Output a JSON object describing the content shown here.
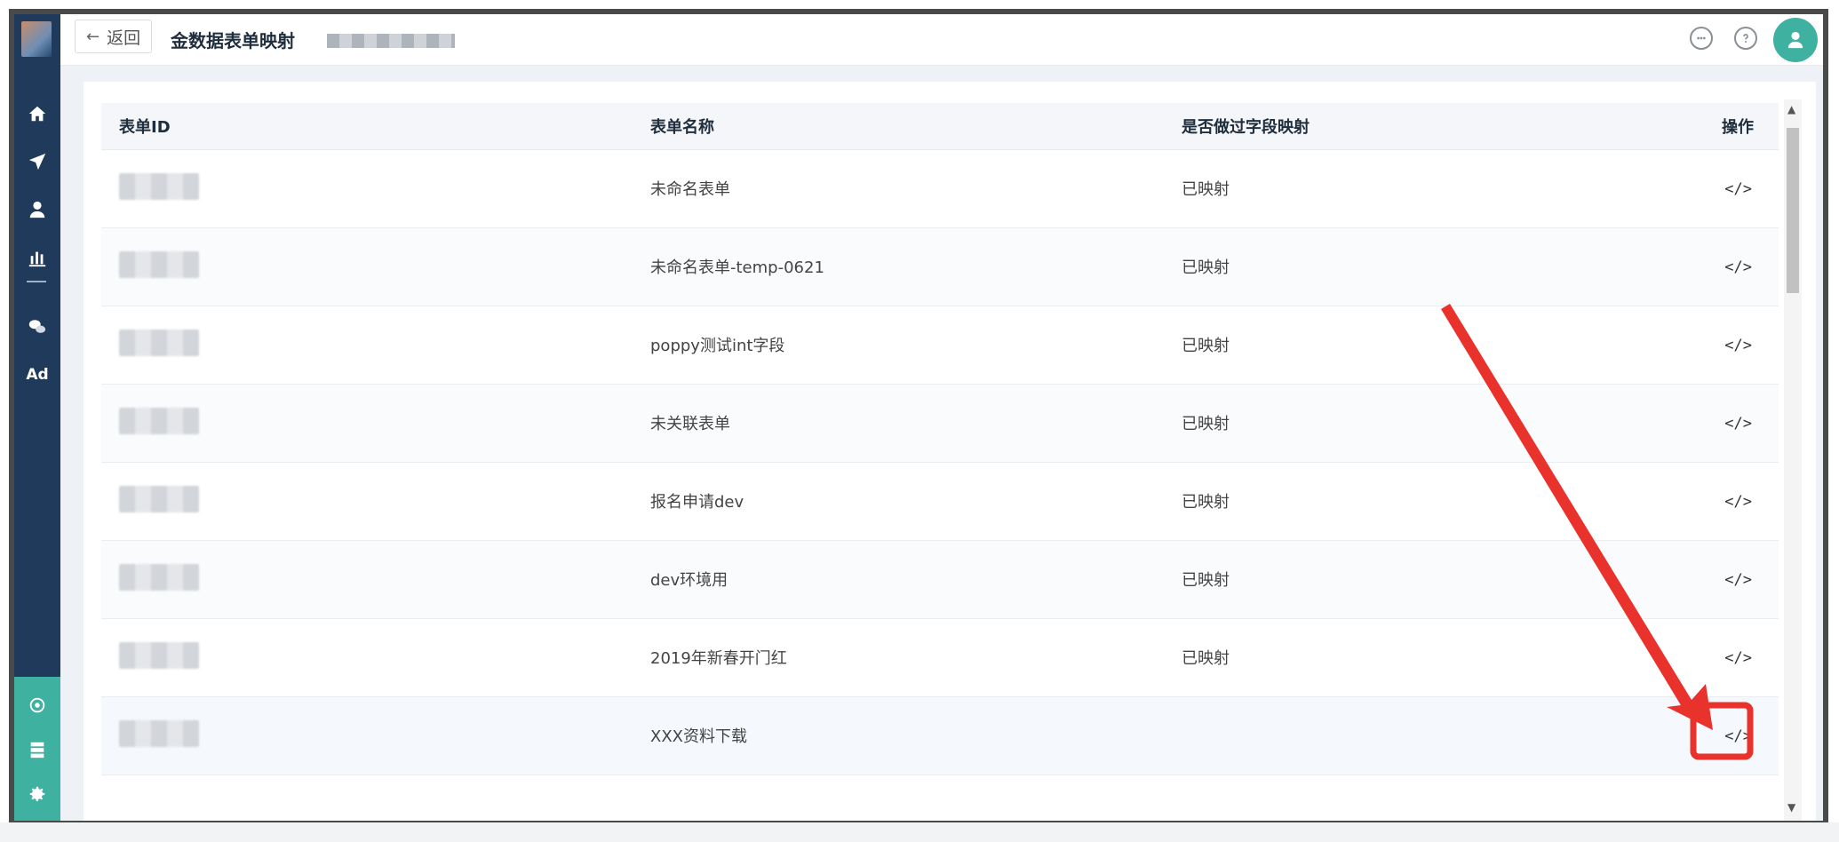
{
  "header": {
    "back_label": "返回",
    "back_arrow": "←",
    "title": "金数据表单映射"
  },
  "icons": {
    "sidebar": [
      "home-icon",
      "send-icon",
      "user-icon",
      "bar-chart-icon",
      "wechat-icon",
      "ad-icon",
      "hub-icon",
      "server-icon",
      "settings-icon"
    ],
    "top": [
      "chat-icon",
      "help-icon",
      "user-avatar-icon"
    ]
  },
  "sidebar": {
    "ad_label": "Ad"
  },
  "table": {
    "columns": [
      "表单ID",
      "表单名称",
      "是否做过字段映射",
      "操作"
    ],
    "rows": [
      {
        "name": "未命名表单",
        "mapped": "已映射",
        "action": "</>"
      },
      {
        "name": "未命名表单-temp-0621",
        "mapped": "已映射",
        "action": "</>"
      },
      {
        "name": "poppy测试int字段",
        "mapped": "已映射",
        "action": "</>"
      },
      {
        "name": "未关联表单",
        "mapped": "已映射",
        "action": "</>"
      },
      {
        "name": "报名申请dev",
        "mapped": "已映射",
        "action": "</>"
      },
      {
        "name": "dev环境用",
        "mapped": "已映射",
        "action": "</>"
      },
      {
        "name": "2019年新春开门红",
        "mapped": "已映射",
        "action": "</>"
      },
      {
        "name": "XXX资料下载",
        "mapped": "",
        "action": "</>"
      }
    ]
  },
  "colors": {
    "sidebar": "#1f3a5a",
    "accent": "#3fb1a1",
    "annotation": "#e8322b"
  }
}
